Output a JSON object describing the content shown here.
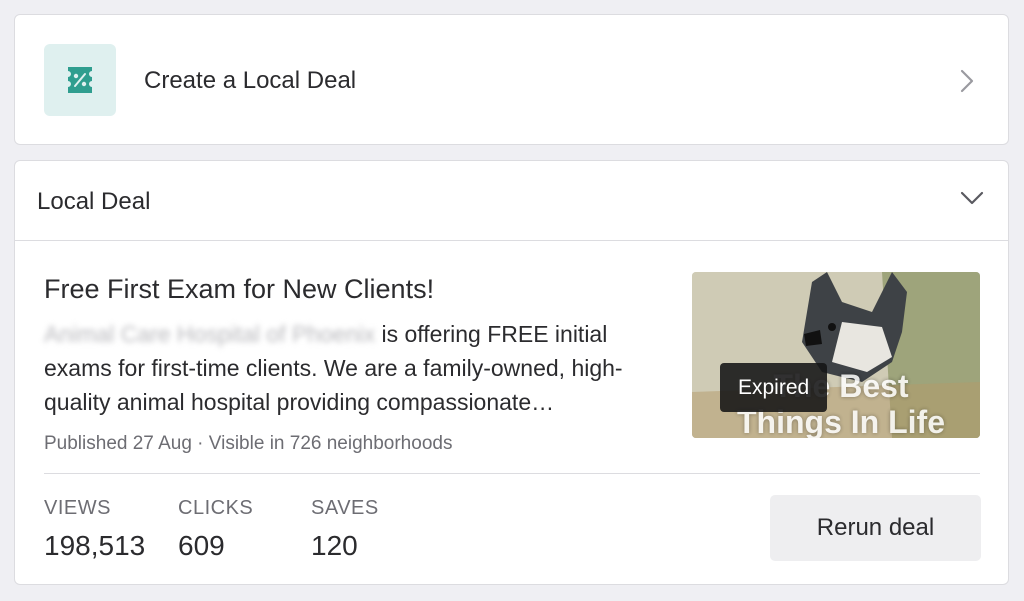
{
  "create_deal": {
    "label": "Create a Local Deal",
    "icon": "discount-ticket-icon",
    "accent": "#2f9e8f"
  },
  "local_deal": {
    "section_title": "Local Deal",
    "title": "Free First Exam for New Clients!",
    "business_name": "Animal Care Hospital of Phoenix",
    "description": "is offering FREE initial exams for first-time clients. We are a family-owned, high-quality animal hospital providing compassionate…",
    "meta": "Published 27 Aug · Visible in 726 neighborhoods",
    "image": {
      "overlay_text": "The Best Things In Life Are FREE",
      "status_badge": "Expired"
    },
    "stats": [
      {
        "label": "VIEWS",
        "value": "198,513"
      },
      {
        "label": "CLICKS",
        "value": "609"
      },
      {
        "label": "SAVES",
        "value": "120"
      }
    ],
    "rerun_label": "Rerun deal"
  }
}
